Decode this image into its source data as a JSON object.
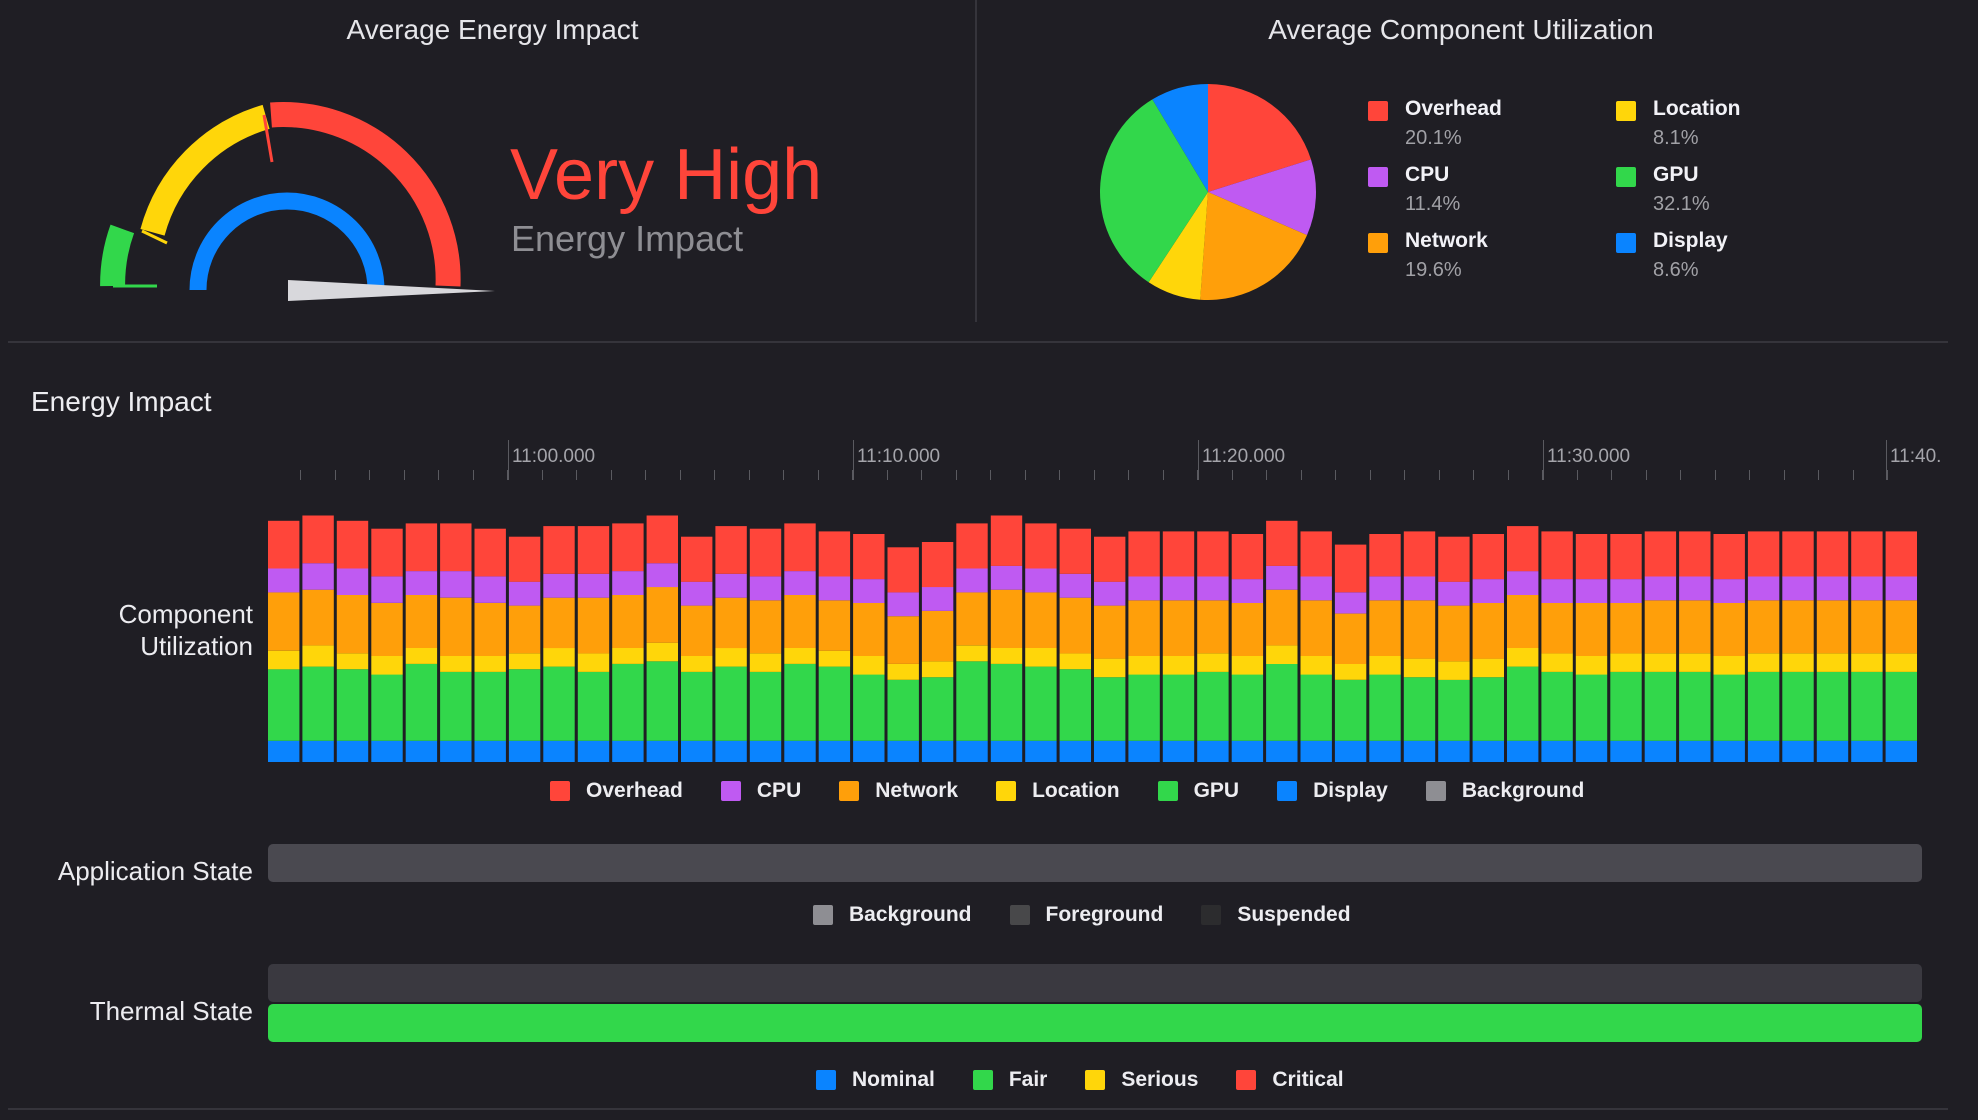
{
  "header": {
    "avg_energy_title": "Average Energy Impact",
    "avg_component_title": "Average Component Utilization"
  },
  "gauge": {
    "level_text": "Very High",
    "sub_text": "Energy Impact",
    "level_color": "#ff453a"
  },
  "pie": {
    "slices": [
      {
        "name": "Overhead",
        "value": 20.1,
        "label": "20.1%",
        "color": "#ff453a"
      },
      {
        "name": "CPU",
        "value": 11.4,
        "label": "11.4%",
        "color": "#bf5af2"
      },
      {
        "name": "Network",
        "value": 19.6,
        "label": "19.6%",
        "color": "#ff9f0a"
      },
      {
        "name": "Location",
        "value": 8.1,
        "label": "8.1%",
        "color": "#ffd60a"
      },
      {
        "name": "GPU",
        "value": 32.1,
        "label": "32.1%",
        "color": "#32d74b"
      },
      {
        "name": "Display",
        "value": 8.6,
        "label": "8.6%",
        "color": "#0a84ff"
      }
    ]
  },
  "energy_section": {
    "title": "Energy Impact",
    "component_label_line1": "Component",
    "component_label_line2": "Utilization",
    "time_ticks": [
      "11:00.000",
      "11:10.000",
      "11:20.000",
      "11:30.000",
      "11:40."
    ],
    "legend": [
      {
        "name": "Overhead",
        "color": "#ff453a"
      },
      {
        "name": "CPU",
        "color": "#bf5af2"
      },
      {
        "name": "Network",
        "color": "#ff9f0a"
      },
      {
        "name": "Location",
        "color": "#ffd60a"
      },
      {
        "name": "GPU",
        "color": "#32d74b"
      },
      {
        "name": "Display",
        "color": "#0a84ff"
      },
      {
        "name": "Background",
        "color": "#8e8e93"
      }
    ]
  },
  "chart_data": {
    "type": "bar",
    "stacked": true,
    "xlabel": "",
    "ylabel": "Component Utilization",
    "x_ticks": [
      "11:00.000",
      "11:10.000",
      "11:20.000",
      "11:30.000",
      "11:40."
    ],
    "series_order": [
      "Display",
      "GPU",
      "Location",
      "Network",
      "CPU",
      "Overhead"
    ],
    "series_colors": {
      "Display": "#0a84ff",
      "GPU": "#32d74b",
      "Location": "#ffd60a",
      "Network": "#ff9f0a",
      "CPU": "#bf5af2",
      "Overhead": "#ff453a"
    },
    "bars": [
      [
        8,
        27,
        7,
        22,
        9,
        18
      ],
      [
        8,
        28,
        8,
        21,
        10,
        18
      ],
      [
        8,
        27,
        6,
        22,
        10,
        18
      ],
      [
        8,
        25,
        7,
        20,
        10,
        18
      ],
      [
        8,
        29,
        6,
        20,
        9,
        18
      ],
      [
        8,
        26,
        6,
        22,
        10,
        18
      ],
      [
        8,
        26,
        6,
        20,
        10,
        18
      ],
      [
        8,
        27,
        6,
        18,
        9,
        17
      ],
      [
        8,
        28,
        7,
        19,
        9,
        18
      ],
      [
        8,
        26,
        7,
        21,
        9,
        18
      ],
      [
        8,
        29,
        6,
        20,
        9,
        18
      ],
      [
        8,
        30,
        7,
        21,
        9,
        18
      ],
      [
        8,
        26,
        6,
        19,
        9,
        17
      ],
      [
        8,
        28,
        7,
        19,
        9,
        18
      ],
      [
        8,
        26,
        7,
        20,
        9,
        18
      ],
      [
        8,
        29,
        6,
        20,
        9,
        18
      ],
      [
        8,
        28,
        6,
        19,
        9,
        17
      ],
      [
        8,
        25,
        7,
        20,
        9,
        17
      ],
      [
        8,
        23,
        6,
        18,
        9,
        17
      ],
      [
        8,
        24,
        6,
        19,
        9,
        17
      ],
      [
        8,
        30,
        6,
        20,
        9,
        17
      ],
      [
        8,
        29,
        6,
        22,
        9,
        19
      ],
      [
        8,
        28,
        7,
        21,
        9,
        17
      ],
      [
        8,
        27,
        6,
        21,
        9,
        17
      ],
      [
        8,
        24,
        7,
        20,
        9,
        17
      ],
      [
        8,
        25,
        7,
        21,
        9,
        17
      ],
      [
        8,
        25,
        7,
        21,
        9,
        17
      ],
      [
        8,
        26,
        7,
        20,
        9,
        17
      ],
      [
        8,
        25,
        7,
        20,
        9,
        17
      ],
      [
        8,
        29,
        7,
        21,
        9,
        17
      ],
      [
        8,
        25,
        7,
        21,
        9,
        17
      ],
      [
        8,
        23,
        6,
        19,
        8,
        18
      ],
      [
        8,
        25,
        7,
        21,
        9,
        16
      ],
      [
        8,
        24,
        7,
        22,
        9,
        17
      ],
      [
        8,
        23,
        7,
        21,
        9,
        17
      ],
      [
        8,
        24,
        7,
        21,
        9,
        17
      ],
      [
        8,
        28,
        7,
        20,
        9,
        17
      ],
      [
        8,
        26,
        7,
        19,
        9,
        18
      ],
      [
        8,
        25,
        7,
        20,
        9,
        17
      ],
      [
        8,
        26,
        7,
        19,
        9,
        17
      ],
      [
        8,
        26,
        7,
        20,
        9,
        17
      ],
      [
        8,
        26,
        7,
        20,
        9,
        17
      ],
      [
        8,
        25,
        7,
        20,
        9,
        17
      ],
      [
        8,
        26,
        7,
        20,
        9,
        17
      ],
      [
        8,
        26,
        7,
        20,
        9,
        17
      ],
      [
        8,
        26,
        7,
        20,
        9,
        17
      ],
      [
        8,
        26,
        7,
        20,
        9,
        17
      ],
      [
        8,
        26,
        7,
        20,
        9,
        17
      ]
    ]
  },
  "app_state": {
    "label": "Application State",
    "legend": [
      {
        "name": "Background",
        "color": "#8e8e93"
      },
      {
        "name": "Foreground",
        "color": "#48484a"
      },
      {
        "name": "Suspended",
        "color": "#2c2c2e"
      }
    ]
  },
  "thermal_state": {
    "label": "Thermal State",
    "legend": [
      {
        "name": "Nominal",
        "color": "#0a84ff"
      },
      {
        "name": "Fair",
        "color": "#32d74b"
      },
      {
        "name": "Serious",
        "color": "#ffd60a"
      },
      {
        "name": "Critical",
        "color": "#ff453a"
      }
    ]
  }
}
